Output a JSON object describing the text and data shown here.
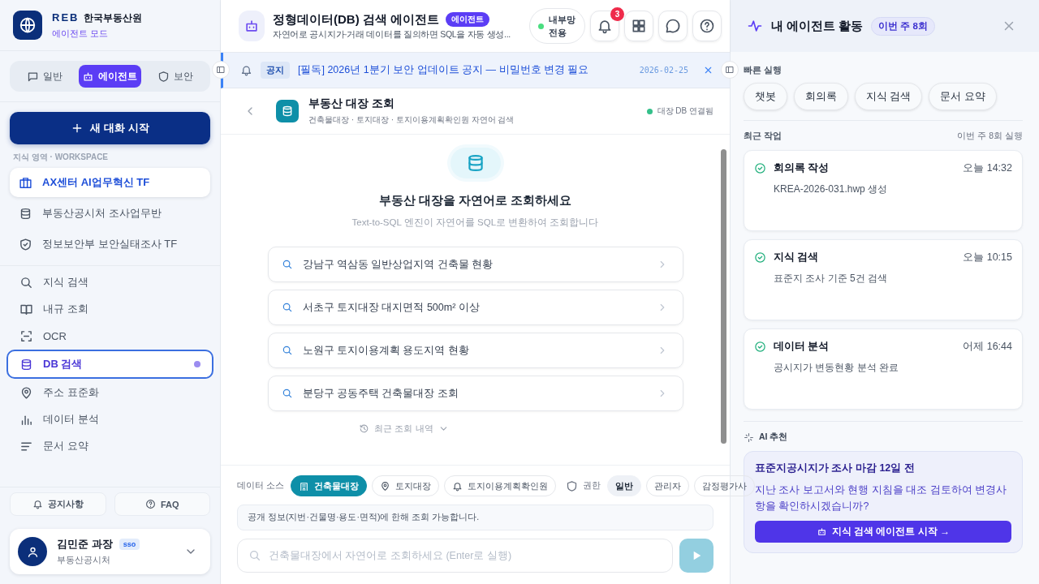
{
  "brand": {
    "logo_text": "REB",
    "name": "한국부동산원",
    "mode": "에이전트 모드"
  },
  "mode_tabs": [
    {
      "label": "일반",
      "selected": false
    },
    {
      "label": "에이전트",
      "selected": true
    },
    {
      "label": "보안",
      "selected": false
    }
  ],
  "new_chat_button": "새 대화 시작",
  "workspace": {
    "heading": "지식 영역 · WORKSPACE",
    "items": [
      {
        "label": "AX센터 AI업무혁신 TF",
        "selected": true
      },
      {
        "label": "부동산공시처 조사업무반",
        "selected": false
      },
      {
        "label": "정보보안부 보안실태조사 TF",
        "selected": false
      }
    ]
  },
  "nav_items": [
    {
      "label": "지식 검색",
      "selected": false
    },
    {
      "label": "내규 조회",
      "selected": false
    },
    {
      "label": "OCR",
      "selected": false
    },
    {
      "label": "DB 검색",
      "selected": true
    },
    {
      "label": "주소 표준화",
      "selected": false
    },
    {
      "label": "데이터 분석",
      "selected": false
    },
    {
      "label": "문서 요약",
      "selected": false
    }
  ],
  "sidebar_footer": {
    "buttons": [
      "공지사항",
      "FAQ"
    ],
    "user": {
      "name": "김민준 과장",
      "badge": "sso",
      "org": "부동산공시처"
    }
  },
  "header": {
    "title": "정형데이터(DB) 검색 에이전트",
    "badge": "에이전트",
    "subtitle": "자연어로 공시지가·거래 데이터를 질의하면 SQL을 자동 생성...",
    "network": "내부망 전용",
    "notification_count": "3"
  },
  "notice": {
    "tag": "공지",
    "text": "[필독] 2026년 1분기 보안 업데이트 공지 — 비밀번호 변경 필요",
    "date": "2026-02-25"
  },
  "subheader": {
    "title": "부동산 대장 조회",
    "subtitle": "건축물대장 · 토지대장 · 토지이용계획확인원 자연어 검색",
    "status": "대장 DB 연결됨"
  },
  "hero": {
    "heading": "부동산 대장을 자연어로 조회하세요",
    "subheading": "Text-to-SQL 엔진이 자연어를 SQL로 변환하여 조회합니다",
    "history": "최근 조회 내역",
    "suggestions": [
      "강남구 역삼동 일반상업지역 건축물 현황",
      "서초구 토지대장 대지면적 500m² 이상",
      "노원구 토지이용계획 용도지역 현황",
      "분당구 공동주택 건축물대장 조회"
    ]
  },
  "query_panel": {
    "source_label": "데이터 소스",
    "sources": [
      {
        "label": "건축물대장",
        "selected": true
      },
      {
        "label": "토지대장",
        "selected": false
      },
      {
        "label": "토지이용계획확인원",
        "selected": false
      }
    ],
    "permission_label": "권한",
    "roles": [
      {
        "label": "일반",
        "selected": true
      },
      {
        "label": "관리자",
        "selected": false
      },
      {
        "label": "감정평가사",
        "selected": false
      }
    ],
    "info": "공개 정보(지번·건물명·용도·면적)에 한해 조회 가능합니다.",
    "placeholder": "건축물대장에서 자연어로 조회하세요 (Enter로 실행)",
    "send_disabled": true
  },
  "activity": {
    "title": "내 에이전트 활동",
    "badge": "이번 주 8회",
    "quick_label": "빠른 실행",
    "quick_actions": [
      "챗봇",
      "회의록",
      "지식 검색",
      "문서 요약"
    ],
    "recent_label": "최근 작업",
    "recent_count": "이번 주 8회 실행",
    "tasks": [
      {
        "title": "회의록 작성",
        "time": "오늘 14:32",
        "detail": "KREA-2026-031.hwp 생성"
      },
      {
        "title": "지식 검색",
        "time": "오늘 10:15",
        "detail": "표준지 조사 기준 5건 검색"
      },
      {
        "title": "데이터 분석",
        "time": "어제 16:44",
        "detail": "공시지가 변동현황 분석 완료"
      }
    ],
    "ai_label": "AI 추천",
    "recommendation": {
      "title": "표준지공시지가 조사 마감 12일 전",
      "text": "지난 조사 보고서와 현행 지침을 대조 검토하여 변경사항을 확인하시겠습니까?",
      "button": "지식 검색 에이전트 시작 →"
    }
  }
}
